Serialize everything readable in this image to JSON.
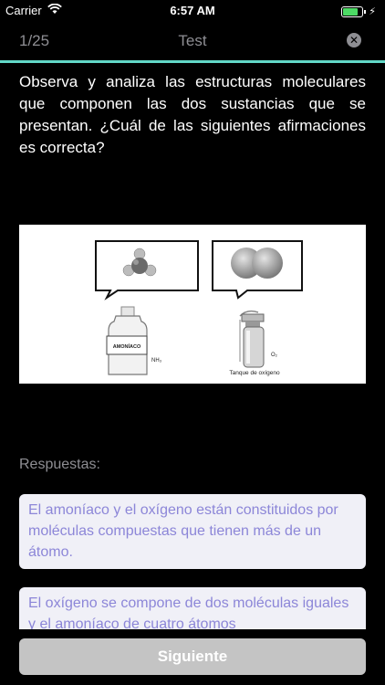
{
  "status": {
    "carrier": "Carrier",
    "time": "6:57 AM",
    "battery_fill": 0.9,
    "battery_color": "#4cd964"
  },
  "nav": {
    "counter": "1/25",
    "title": "Test",
    "close_icon": "close-circle-icon"
  },
  "question": {
    "text": "Observa y analiza las estructuras moleculares que componen las dos sustancias que se presentan. ¿Cuál de las siguientes afirmaciones es correcta?"
  },
  "figure": {
    "bottle_label": "AMONÍACO",
    "nh3_label": "NH₃",
    "o2_label": "O₂",
    "tank_caption": "Tanque de oxígeno"
  },
  "answers": {
    "label": "Respuestas:",
    "options": [
      "El amoníaco y el oxígeno están constituidos por moléculas compuestas que tienen más de un átomo.",
      "El oxígeno se compone de dos moléculas iguales y el amoníaco de cuatro átomos"
    ]
  },
  "footer": {
    "next_label": "Siguiente"
  },
  "colors": {
    "accent": "#62d8c7",
    "option_text": "#8c86d8",
    "option_bg": "#f0f0f7",
    "button_bg": "#c4c4c4"
  }
}
